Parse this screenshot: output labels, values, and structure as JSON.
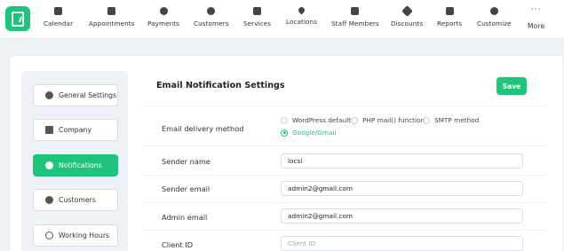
{
  "nav": {
    "items": [
      {
        "label": "Calendar",
        "icon": "calendar-icon"
      },
      {
        "label": "Appointments",
        "icon": "appointments-icon"
      },
      {
        "label": "Payments",
        "icon": "payments-icon"
      },
      {
        "label": "Customers",
        "icon": "customers-icon"
      },
      {
        "label": "Services",
        "icon": "services-icon"
      },
      {
        "label": "Locations",
        "icon": "location-pin-icon"
      },
      {
        "label": "Staff Members",
        "icon": "staff-icon"
      },
      {
        "label": "Discounts",
        "icon": "tag-icon"
      },
      {
        "label": "Reports",
        "icon": "reports-icon"
      },
      {
        "label": "Customize",
        "icon": "palette-icon"
      }
    ],
    "more_label": "More",
    "more_icon": "ellipsis-icon"
  },
  "sidebar": {
    "items": [
      {
        "label": "General Settings",
        "icon": "gear-icon",
        "active": false
      },
      {
        "label": "Company",
        "icon": "building-icon",
        "active": false
      },
      {
        "label": "Notifications",
        "icon": "bell-icon",
        "active": true
      },
      {
        "label": "Customers",
        "icon": "customers-icon",
        "active": false
      },
      {
        "label": "Working Hours",
        "icon": "clock-icon",
        "active": false
      }
    ]
  },
  "panel": {
    "title": "Email Notification Settings",
    "save_label": "Save",
    "delivery": {
      "label": "Email delivery method",
      "options": [
        "WordPress default",
        "PHP mail() function",
        "SMTP method",
        "Google/Gmail"
      ],
      "selected": "Google/Gmail"
    },
    "sender_name": {
      "label": "Sender name",
      "value": "locsl"
    },
    "sender_email": {
      "label": "Sender email",
      "value": "admin2@gmail.com"
    },
    "admin_email": {
      "label": "Admin email",
      "value": "admin2@gmail.com"
    },
    "client_id": {
      "label": "Client ID",
      "placeholder": "Client ID"
    }
  },
  "colors": {
    "accent": "#1fc47c",
    "background": "#eef1f6"
  }
}
